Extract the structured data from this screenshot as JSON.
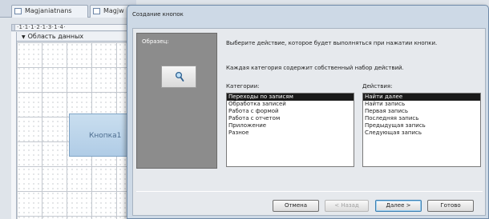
{
  "access": {
    "tabs": [
      {
        "label": "Magjaniatnans"
      },
      {
        "label": "Magjw"
      }
    ],
    "ruler_text": "·1·1·1·2·1·3·1·4·",
    "section_label": "Область данных",
    "form_button_label": "Кнопка1"
  },
  "dialog": {
    "title": "Создание кнопок",
    "preview_label": "Образец:",
    "instruction": "Выберите действие, которое будет выполняться при нажатии кнопки.",
    "group_note": "Каждая категория содержит собственный набор действий.",
    "categories_label": "Категории:",
    "actions_label": "Действия:",
    "categories": [
      {
        "label": "Переходы по записям",
        "selected": true
      },
      {
        "label": "Обработка записей",
        "selected": false
      },
      {
        "label": "Работа с формой",
        "selected": false
      },
      {
        "label": "Работа с отчетом",
        "selected": false
      },
      {
        "label": "Приложение",
        "selected": false
      },
      {
        "label": "Разное",
        "selected": false
      }
    ],
    "actions": [
      {
        "label": "Найти далее",
        "selected": true
      },
      {
        "label": "Найти запись",
        "selected": false
      },
      {
        "label": "Первая запись",
        "selected": false
      },
      {
        "label": "Последняя запись",
        "selected": false
      },
      {
        "label": "Предыдущая запись",
        "selected": false
      },
      {
        "label": "Следующая запись",
        "selected": false
      }
    ],
    "buttons": {
      "cancel": "Отмена",
      "back": "< Назад",
      "next": "Далее >",
      "finish": "Готово"
    }
  },
  "colors": {
    "selection": "#1a1a1a",
    "preview_panel": "#8c8c8c",
    "form_button": "#b0cce6"
  },
  "icons": {
    "preview_button_icon": "magnifier-icon"
  }
}
